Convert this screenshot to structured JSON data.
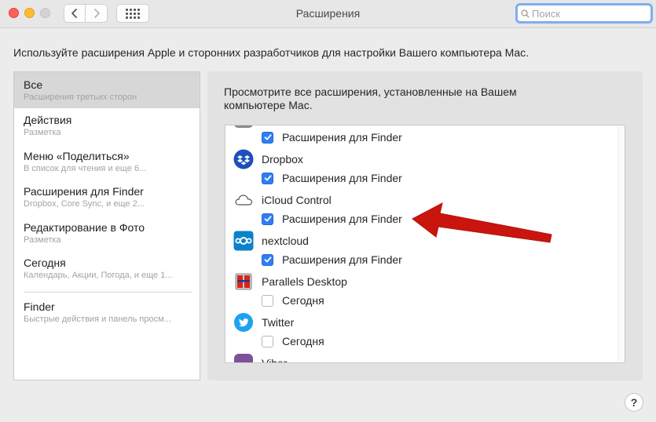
{
  "window": {
    "title": "Расширения"
  },
  "search": {
    "placeholder": "Поиск"
  },
  "description": "Используйте расширения Apple и сторонних разработчиков для настройки Вашего компьютера Mac.",
  "sidebar": {
    "items": [
      {
        "title": "Все",
        "subtitle": "Расширения третьих сторон"
      },
      {
        "title": "Действия",
        "subtitle": "Разметка"
      },
      {
        "title": "Меню «Поделиться»",
        "subtitle": "В список для чтения и еще 6..."
      },
      {
        "title": "Расширения для Finder",
        "subtitle": "Dropbox, Core Sync, и еще 2..."
      },
      {
        "title": "Редактирование в Фото",
        "subtitle": "Разметка"
      },
      {
        "title": "Сегодня",
        "subtitle": "Календарь, Акции, Погода, и еще 1..."
      },
      {
        "title": "Finder",
        "subtitle": "Быстрые действия и панель просм..."
      }
    ]
  },
  "main": {
    "title": "Просмотрите все расширения, установленные на Вашем компьютере Mac.",
    "extensions": [
      {
        "app": "",
        "icon": "partial-icon",
        "option": "Расширения для Finder",
        "checked": true
      },
      {
        "app": "Dropbox",
        "icon": "dropbox-icon",
        "option": "Расширения для Finder",
        "checked": true
      },
      {
        "app": "iCloud Control",
        "icon": "icloud-icon",
        "option": "Расширения для Finder",
        "checked": true
      },
      {
        "app": "nextcloud",
        "icon": "nextcloud-icon",
        "option": "Расширения для Finder",
        "checked": true
      },
      {
        "app": "Parallels Desktop",
        "icon": "parallels-icon",
        "option": "Сегодня",
        "checked": false
      },
      {
        "app": "Twitter",
        "icon": "twitter-icon",
        "option": "Сегодня",
        "checked": false
      },
      {
        "app": "Viber",
        "icon": "viber-icon",
        "option": "",
        "checked": false
      }
    ]
  },
  "help": {
    "label": "?"
  },
  "colors": {
    "accent": "#2f7df6",
    "arrow": "#c9150e",
    "selected_row": "#d7d7d7"
  }
}
